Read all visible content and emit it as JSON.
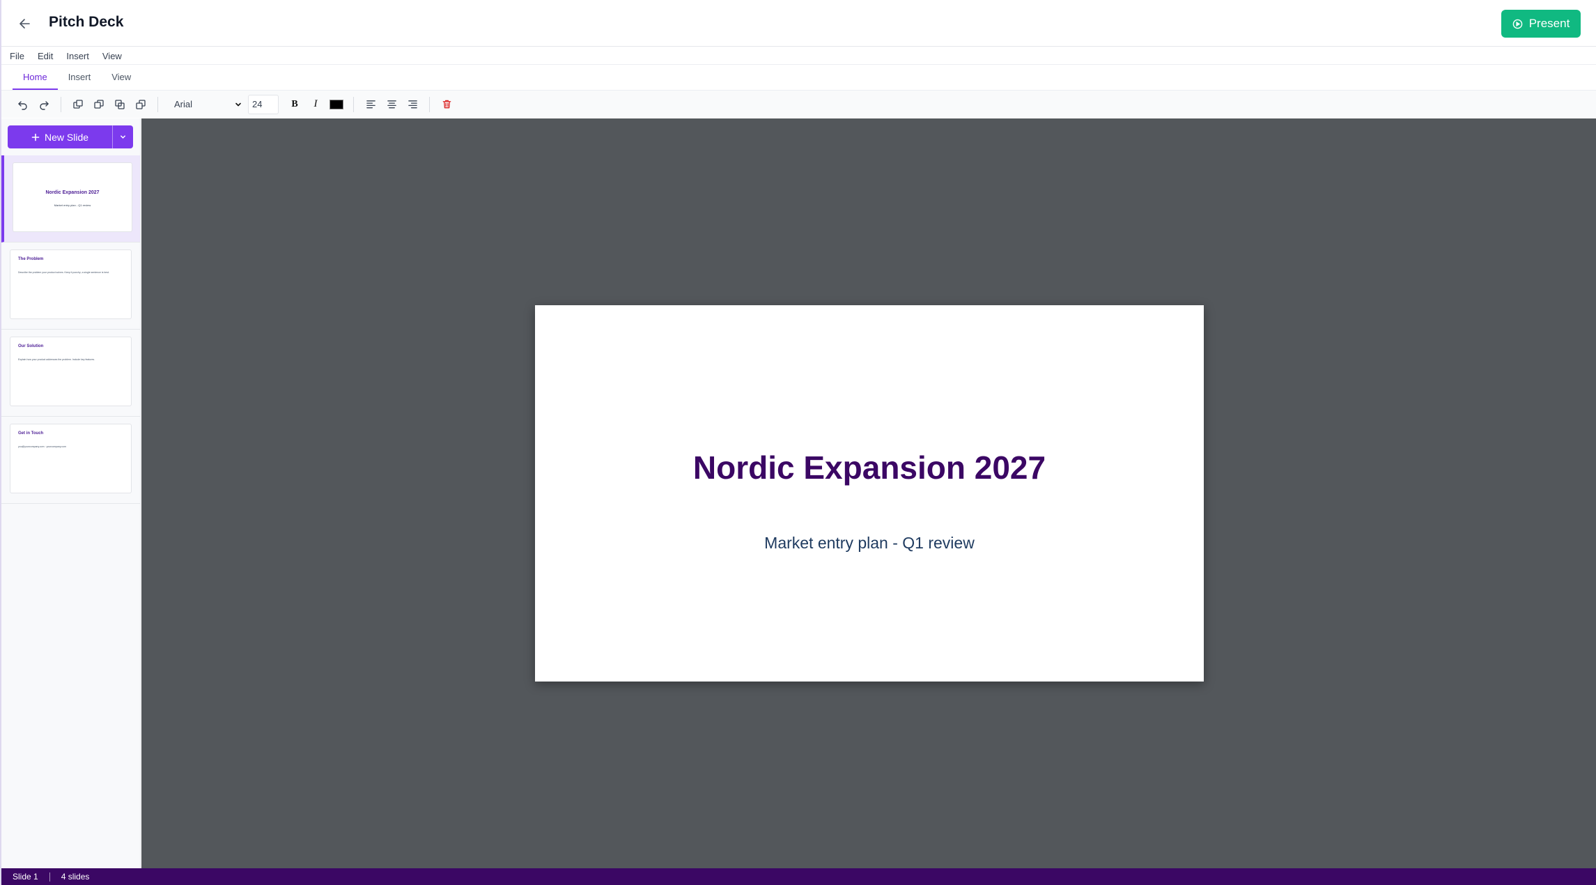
{
  "header": {
    "title": "Pitch Deck",
    "present_label": "Present"
  },
  "menubar": {
    "items": [
      "File",
      "Edit",
      "Insert",
      "View"
    ]
  },
  "ribbon": {
    "tabs": [
      "Home",
      "Insert",
      "View"
    ],
    "active_tab": "Home"
  },
  "toolbar": {
    "font_family": "Arial",
    "font_size": "24",
    "text_color": "#000000"
  },
  "sidebar": {
    "new_slide_label": "New Slide",
    "slides": [
      {
        "title": "Nordic Expansion 2027",
        "body": "Market entry plan - Q1 review"
      },
      {
        "title": "The Problem",
        "body": "Describe the problem your product solves. Keep it punchy; a single sentence is best."
      },
      {
        "title": "Our Solution",
        "body": "Explain how your product addresses the problem. Include key features."
      },
      {
        "title": "Get in Touch",
        "body": "you@yourcompany.com    ·    yourcompany.com"
      }
    ]
  },
  "slide": {
    "title": "Nordic Expansion 2027",
    "subtitle": "Market entry plan - Q1 review"
  },
  "status": {
    "current": "Slide 1",
    "count": "4 slides"
  },
  "colors": {
    "accent": "#7c3aed",
    "present": "#10b981",
    "status_bar": "#3b0764",
    "title_text": "#3b0764",
    "canvas": "#53575b"
  }
}
